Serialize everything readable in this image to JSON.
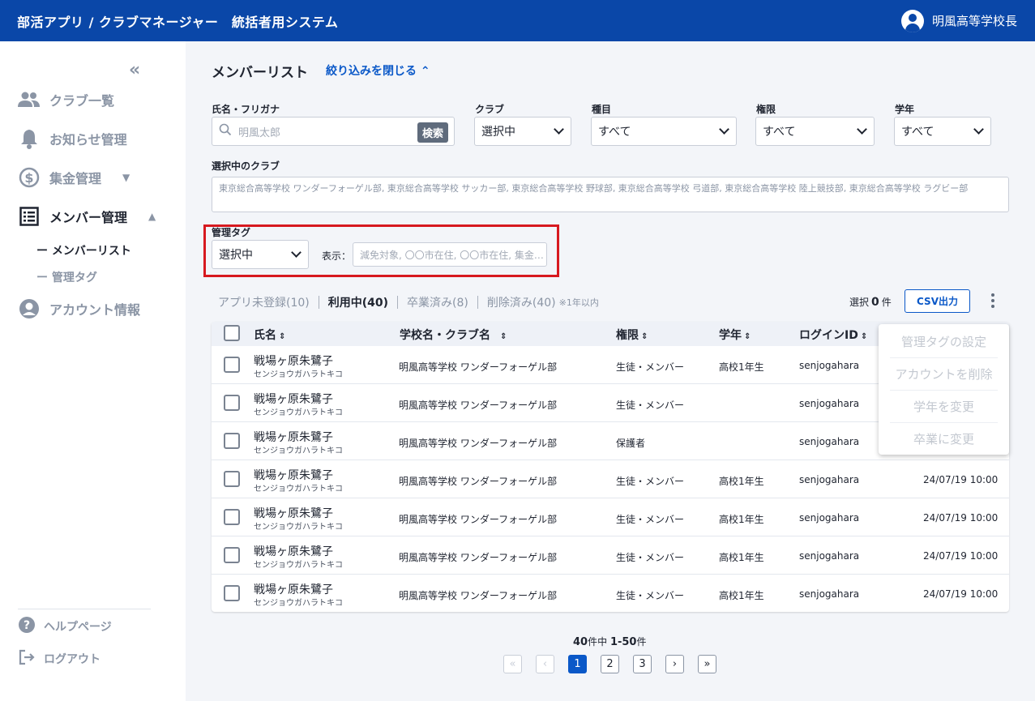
{
  "header": {
    "title": "部活アプリ / クラブマネージャー　統括者用システム",
    "user_name": "明風高等学校長"
  },
  "sidebar": {
    "collapse_label": "«",
    "items": [
      {
        "label": "クラブ一覧",
        "icon": "people-icon"
      },
      {
        "label": "お知らせ管理",
        "icon": "bell-icon"
      },
      {
        "label": "集金管理",
        "icon": "dollar-icon"
      },
      {
        "label": "メンバー管理",
        "icon": "list-icon"
      },
      {
        "label": "アカウント情報",
        "icon": "account-icon"
      }
    ],
    "sub_items": [
      "ー メンバーリスト",
      "ー 管理タグ"
    ],
    "footer": [
      {
        "label": "ヘルプページ",
        "icon": "help-icon"
      },
      {
        "label": "ログアウト",
        "icon": "logout-icon"
      }
    ]
  },
  "page": {
    "title": "メンバーリスト",
    "filter_toggle": "絞り込みを閉じる"
  },
  "filters": {
    "name_label": "氏名・フリガナ",
    "name_placeholder": "明風太郎",
    "search_button": "検索",
    "club_label": "クラブ",
    "club_value": "選択中",
    "category_label": "種目",
    "category_value": "すべて",
    "role_label": "権限",
    "role_value": "すべて",
    "grade_label": "学年",
    "grade_value": "すべて",
    "selected_clubs_label": "選択中のクラブ",
    "selected_clubs": "東京総合高等学校 ワンダーフォーゲル部, 東京総合高等学校 サッカー部, 東京総合高等学校 野球部, 東京総合高等学校 弓道部, 東京総合高等学校 陸上競技部, 東京総合高等学校 ラグビー部",
    "tag_label": "管理タグ",
    "tag_value": "選択中",
    "display_label": "表示：",
    "tag_display": "減免対象, 〇〇市在住, 〇〇市在住, 集金…"
  },
  "tabs": [
    {
      "label": "アプリ未登録(10)"
    },
    {
      "label": "利用中(40)"
    },
    {
      "label": "卒業済み(8)"
    },
    {
      "label": "削除済み(40)"
    }
  ],
  "tab_note": "※1年以内",
  "selection": {
    "prefix": "選択",
    "count": "0",
    "suffix": "件"
  },
  "csv_button": "CSV出力",
  "table": {
    "headers": {
      "name": "氏名",
      "school": "学校名・クラブ名",
      "role": "権限",
      "grade": "学年",
      "login": "ログインID"
    },
    "rows": [
      {
        "name": "戦場ヶ原朱鷺子",
        "kana": "センジョウガハラトキコ",
        "school": "明風高等学校 ワンダーフォーゲル部",
        "role": "生徒・メンバー",
        "grade": "高校1年生",
        "login": "senjogahara",
        "date": ""
      },
      {
        "name": "戦場ヶ原朱鷺子",
        "kana": "センジョウガハラトキコ",
        "school": "明風高等学校 ワンダーフォーゲル部",
        "role": "生徒・メンバー",
        "grade": "",
        "login": "senjogahara",
        "date": ""
      },
      {
        "name": "戦場ヶ原朱鷺子",
        "kana": "センジョウガハラトキコ",
        "school": "明風高等学校 ワンダーフォーゲル部",
        "role": "保護者",
        "grade": "",
        "login": "senjogahara",
        "date": ""
      },
      {
        "name": "戦場ヶ原朱鷺子",
        "kana": "センジョウガハラトキコ",
        "school": "明風高等学校 ワンダーフォーゲル部",
        "role": "生徒・メンバー",
        "grade": "高校1年生",
        "login": "senjogahara",
        "date": "24/07/19 10:00"
      },
      {
        "name": "戦場ヶ原朱鷺子",
        "kana": "センジョウガハラトキコ",
        "school": "明風高等学校 ワンダーフォーゲル部",
        "role": "生徒・メンバー",
        "grade": "高校1年生",
        "login": "senjogahara",
        "date": "24/07/19 10:00"
      },
      {
        "name": "戦場ヶ原朱鷺子",
        "kana": "センジョウガハラトキコ",
        "school": "明風高等学校 ワンダーフォーゲル部",
        "role": "生徒・メンバー",
        "grade": "高校1年生",
        "login": "senjogahara",
        "date": "24/07/19 10:00"
      },
      {
        "name": "戦場ヶ原朱鷺子",
        "kana": "センジョウガハラトキコ",
        "school": "明風高等学校 ワンダーフォーゲル部",
        "role": "生徒・メンバー",
        "grade": "高校1年生",
        "login": "senjogahara",
        "date": "24/07/19 10:00"
      }
    ]
  },
  "action_menu": [
    "管理タグの設定",
    "アカウントを削除",
    "学年を変更",
    "卒業に変更"
  ],
  "pagination": {
    "total": "40",
    "total_suffix": "件中",
    "range": "1-50",
    "range_suffix": "件",
    "pages": [
      "1",
      "2",
      "3"
    ],
    "current": "1"
  },
  "colors": {
    "header_bg": "#0a47a8",
    "accent": "#0a58c8",
    "highlight": "#d7191f"
  }
}
